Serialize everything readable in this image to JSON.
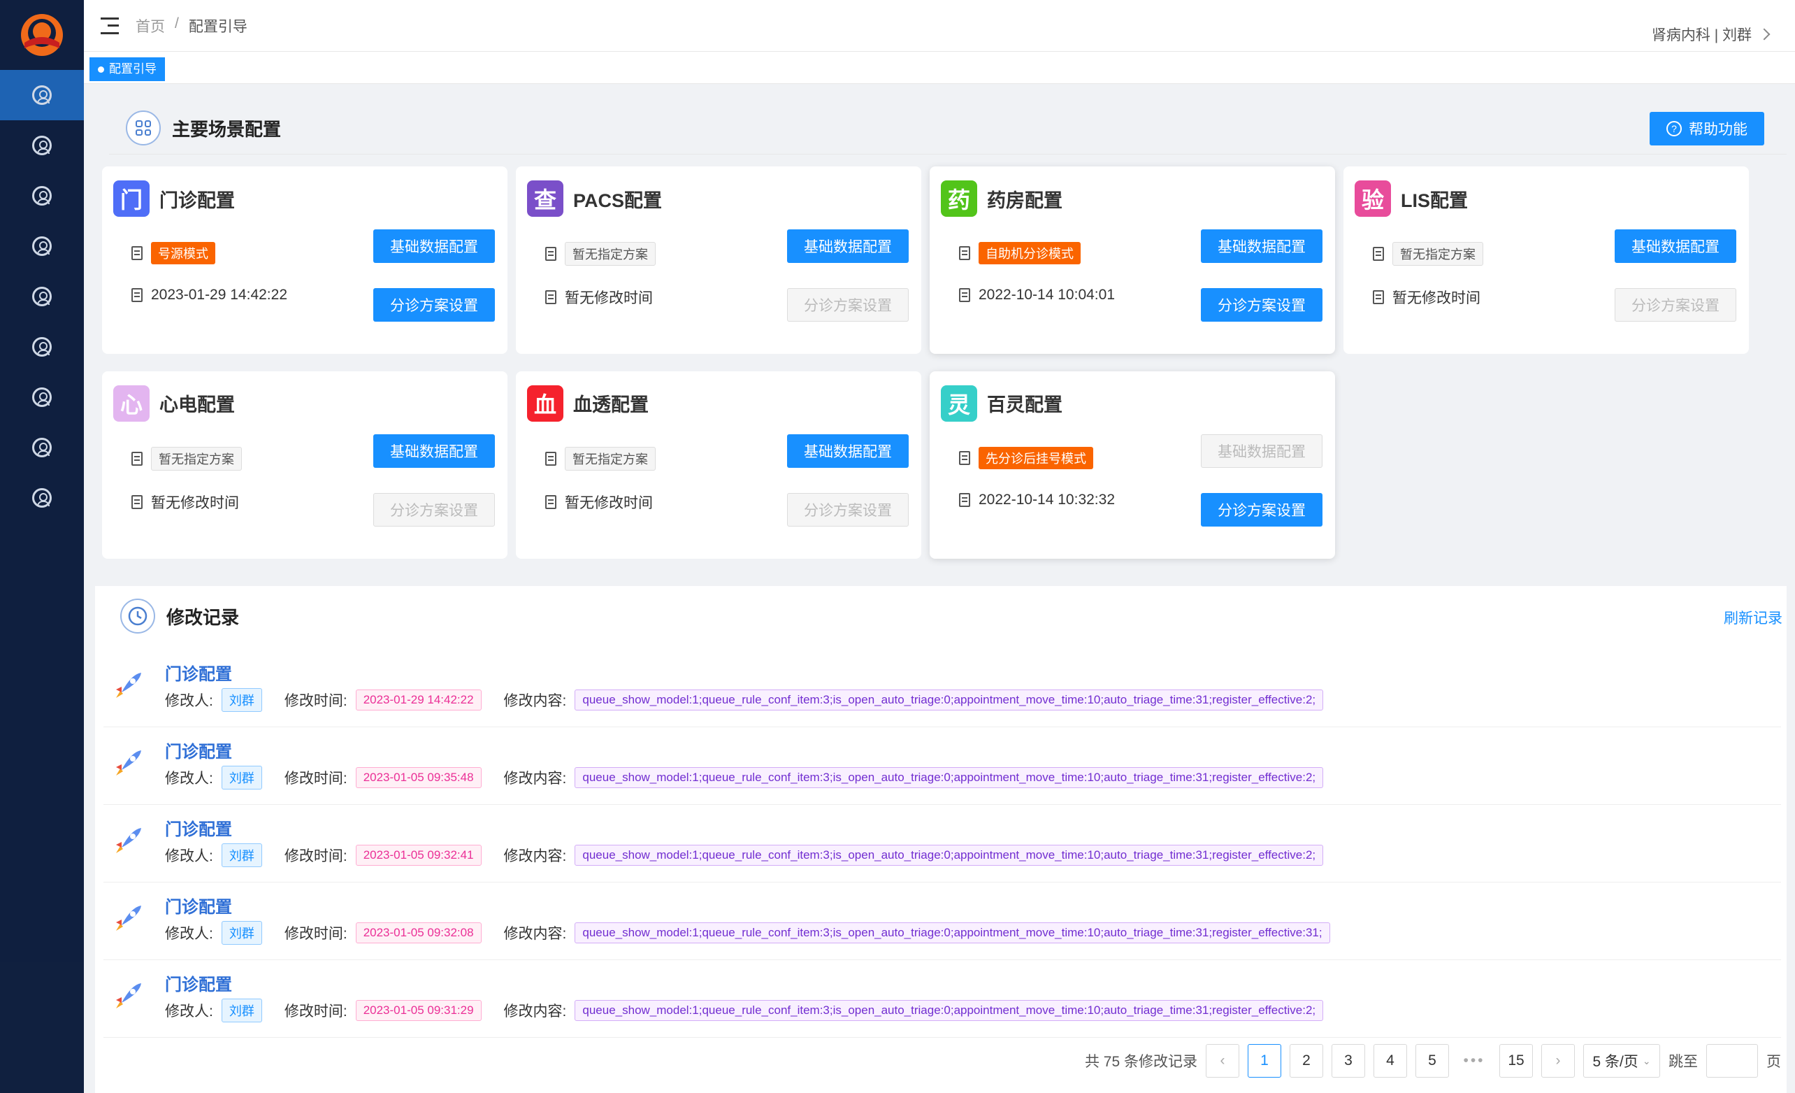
{
  "breadcrumb": {
    "home": "首页",
    "sep": "/",
    "current": "配置引导"
  },
  "user": "肾病内科 | 刘群",
  "tabs": [
    {
      "label": "配置引导"
    }
  ],
  "section": {
    "title": "主要场景配置",
    "help_label": "帮助功能"
  },
  "cards": [
    {
      "badge": "门",
      "badge_color": "#4f6ef7",
      "title": "门诊配置",
      "mode": "号源模式",
      "mode_style": "orange",
      "time": "2023-01-29 14:42:22",
      "basic_label": "基础数据配置",
      "basic_enabled": true,
      "plan_label": "分诊方案设置",
      "plan_enabled": true
    },
    {
      "badge": "查",
      "badge_color": "#7a4fc9",
      "title": "PACS配置",
      "mode": "暂无指定方案",
      "mode_style": "gray",
      "time": "暂无修改时间",
      "basic_label": "基础数据配置",
      "basic_enabled": true,
      "plan_label": "分诊方案设置",
      "plan_enabled": false
    },
    {
      "badge": "药",
      "badge_color": "#52c41a",
      "title": "药房配置",
      "mode": "自助机分诊模式",
      "mode_style": "orange",
      "time": "2022-10-14 10:04:01",
      "basic_label": "基础数据配置",
      "basic_enabled": true,
      "plan_label": "分诊方案设置",
      "plan_enabled": true
    },
    {
      "badge": "验",
      "badge_color": "#e84c9b",
      "title": "LIS配置",
      "mode": "暂无指定方案",
      "mode_style": "gray",
      "time": "暂无修改时间",
      "basic_label": "基础数据配置",
      "basic_enabled": true,
      "plan_label": "分诊方案设置",
      "plan_enabled": false
    },
    {
      "badge": "心",
      "badge_color": "#e3b5f0",
      "title": "心电配置",
      "mode": "暂无指定方案",
      "mode_style": "gray",
      "time": "暂无修改时间",
      "basic_label": "基础数据配置",
      "basic_enabled": true,
      "plan_label": "分诊方案设置",
      "plan_enabled": false
    },
    {
      "badge": "血",
      "badge_color": "#f5222d",
      "title": "血透配置",
      "mode": "暂无指定方案",
      "mode_style": "gray",
      "time": "暂无修改时间",
      "basic_label": "基础数据配置",
      "basic_enabled": true,
      "plan_label": "分诊方案设置",
      "plan_enabled": false
    },
    {
      "badge": "灵",
      "badge_color": "#36cfc9",
      "title": "百灵配置",
      "mode": "先分诊后挂号模式",
      "mode_style": "orange",
      "time": "2022-10-14 10:32:32",
      "basic_label": "基础数据配置",
      "basic_enabled": false,
      "plan_label": "分诊方案设置",
      "plan_enabled": true
    }
  ],
  "records": {
    "title": "修改记录",
    "refresh_label": "刷新记录",
    "labels": {
      "modifier": "修改人:",
      "time": "修改时间:",
      "content": "修改内容:"
    },
    "items": [
      {
        "title": "门诊配置",
        "user": "刘群",
        "time": "2023-01-29 14:42:22",
        "content": "queue_show_model:1;queue_rule_conf_item:3;is_open_auto_triage:0;appointment_move_time:10;auto_triage_time:31;register_effective:2;"
      },
      {
        "title": "门诊配置",
        "user": "刘群",
        "time": "2023-01-05 09:35:48",
        "content": "queue_show_model:1;queue_rule_conf_item:3;is_open_auto_triage:0;appointment_move_time:10;auto_triage_time:31;register_effective:2;"
      },
      {
        "title": "门诊配置",
        "user": "刘群",
        "time": "2023-01-05 09:32:41",
        "content": "queue_show_model:1;queue_rule_conf_item:3;is_open_auto_triage:0;appointment_move_time:10;auto_triage_time:31;register_effective:2;"
      },
      {
        "title": "门诊配置",
        "user": "刘群",
        "time": "2023-01-05 09:32:08",
        "content": "queue_show_model:1;queue_rule_conf_item:3;is_open_auto_triage:0;appointment_move_time:10;auto_triage_time:31;register_effective:31;"
      },
      {
        "title": "门诊配置",
        "user": "刘群",
        "time": "2023-01-05 09:31:29",
        "content": "queue_show_model:1;queue_rule_conf_item:3;is_open_auto_triage:0;appointment_move_time:10;auto_triage_time:31;register_effective:2;"
      }
    ]
  },
  "pagination": {
    "total_text": "共 75 条修改记录",
    "pages": [
      "1",
      "2",
      "3",
      "4",
      "5"
    ],
    "ellipsis": "•••",
    "last_page": "15",
    "current": "1",
    "page_size": "5 条/页",
    "jump_label": "跳至",
    "page_suffix": "页"
  },
  "colors": {
    "primary": "#1890ff",
    "sidebar": "#0f1f3f",
    "sidebar_active": "#1e63b3",
    "orange_tag": "#fa6400"
  }
}
